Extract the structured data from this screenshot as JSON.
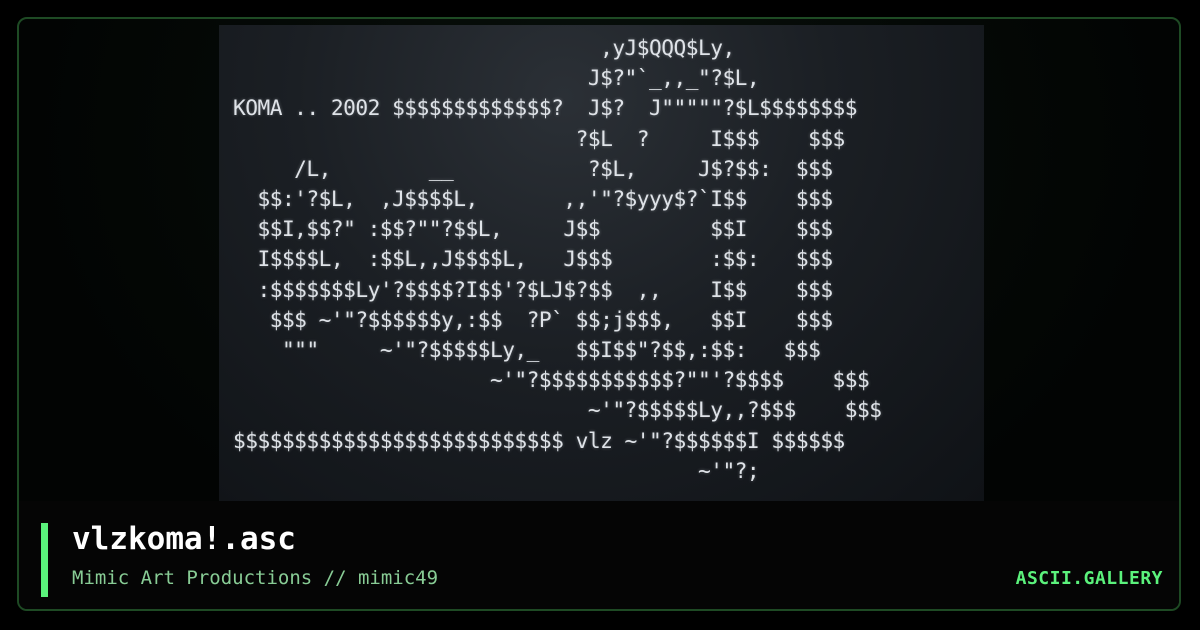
{
  "artwork": {
    "lines": [
      "                              ,yJ$QQQ$Ly,",
      "                             J$?\"`_,,_\"?$L,",
      "KOMA .. 2002 $$$$$$$$$$$$$?  J$?  J\"\"\"\"\"?$L$$$$$$$$",
      "                            ?$L  ?     I$$$    $$$",
      "     /L,        __           ?$L,     J$?$$:  $$$",
      "  $$:'?$L,  ,J$$$$L,       ,,'\"?$yyy$?`I$$    $$$",
      "  $$I,$$?\" :$$?\"\"?$$L,     J$$         $$I    $$$",
      "  I$$$$L,  :$$L,,J$$$$L,   J$$$        :$$:   $$$",
      "  :$$$$$$$Ly'?$$$$?I$$'?$LJ$?$$  ,,    I$$    $$$",
      "   $$$ ~'\"?$$$$$$y,:$$  ?P` $$;j$$$,   $$I    $$$",
      "    \"\"\"     ~'\"?$$$$$Ly,_   $$I$$\"?$$,:$$:   $$$",
      "                     ~'\"?$$$$$$$$$$$?\"\"'?$$$$    $$$",
      "                             ~'\"?$$$$$Ly,,?$$$    $$$",
      "$$$$$$$$$$$$$$$$$$$$$$$$$$$ vlz ~'\"?$$$$$$I $$$$$$",
      "                                      ~'\"?;"
    ]
  },
  "footer": {
    "title": "vlzkoma!.asc",
    "subtitle": "Mimic Art Productions // mimic49",
    "brand": "ASCII.GALLERY"
  }
}
